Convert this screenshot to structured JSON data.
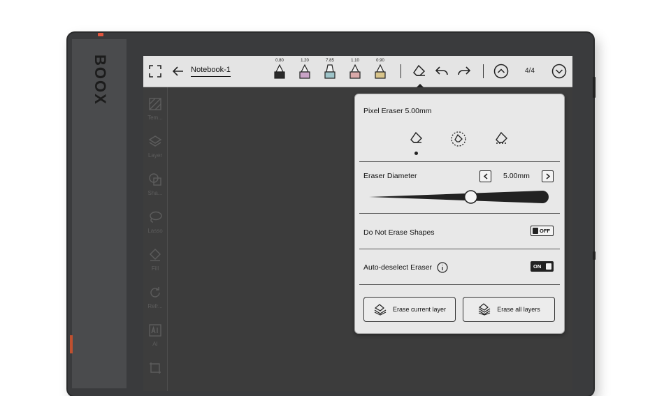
{
  "device": {
    "brand": "BOOX"
  },
  "toolbar": {
    "notebook_name": "Notebook-1",
    "page_indicator": "4/4",
    "pens": [
      {
        "width_label": "0.80",
        "color": "#2a2a2a",
        "icon": "pen-icon"
      },
      {
        "width_label": "1.20",
        "color": "#c9a3c6",
        "icon": "pen-icon"
      },
      {
        "width_label": "7.85",
        "color": "#9ec4c9",
        "icon": "marker-icon"
      },
      {
        "width_label": "1.10",
        "color": "#d9a9a9",
        "icon": "pen-icon"
      },
      {
        "width_label": "0.90",
        "color": "#d8c48a",
        "icon": "pen-icon"
      }
    ],
    "icons": [
      "fullscreen-icon",
      "back-arrow-icon",
      "eraser-icon",
      "undo-icon",
      "redo-icon",
      "page-up-icon",
      "page-down-icon"
    ]
  },
  "left_toolbar": {
    "items": [
      {
        "label": "Tem...",
        "icon": "template-icon"
      },
      {
        "label": "Layer",
        "icon": "layer-icon"
      },
      {
        "label": "Sha...",
        "icon": "shape-icon"
      },
      {
        "label": "Lasso",
        "icon": "lasso-icon"
      },
      {
        "label": "Fill",
        "icon": "fill-icon"
      },
      {
        "label": "Refr...",
        "icon": "refresh-icon"
      },
      {
        "label": "AI",
        "icon": "ai-icon"
      }
    ]
  },
  "eraser_panel": {
    "title": "Pixel Eraser 5.00mm",
    "modes": [
      {
        "icon": "pixel-eraser-icon",
        "selected": true
      },
      {
        "icon": "stroke-eraser-icon",
        "selected": false
      },
      {
        "icon": "segment-eraser-icon",
        "selected": false
      }
    ],
    "diameter_label": "Eraser Diameter",
    "diameter_value": "5.00mm",
    "diameter_slider_fraction": 0.57,
    "do_not_erase_shapes_label": "Do Not Erase Shapes",
    "do_not_erase_shapes_state": "OFF",
    "auto_deselect_label": "Auto-deselect Eraser",
    "auto_deselect_state": "ON",
    "erase_current_layer_label": "Erase current layer",
    "erase_all_layers_label": "Erase all layers"
  }
}
